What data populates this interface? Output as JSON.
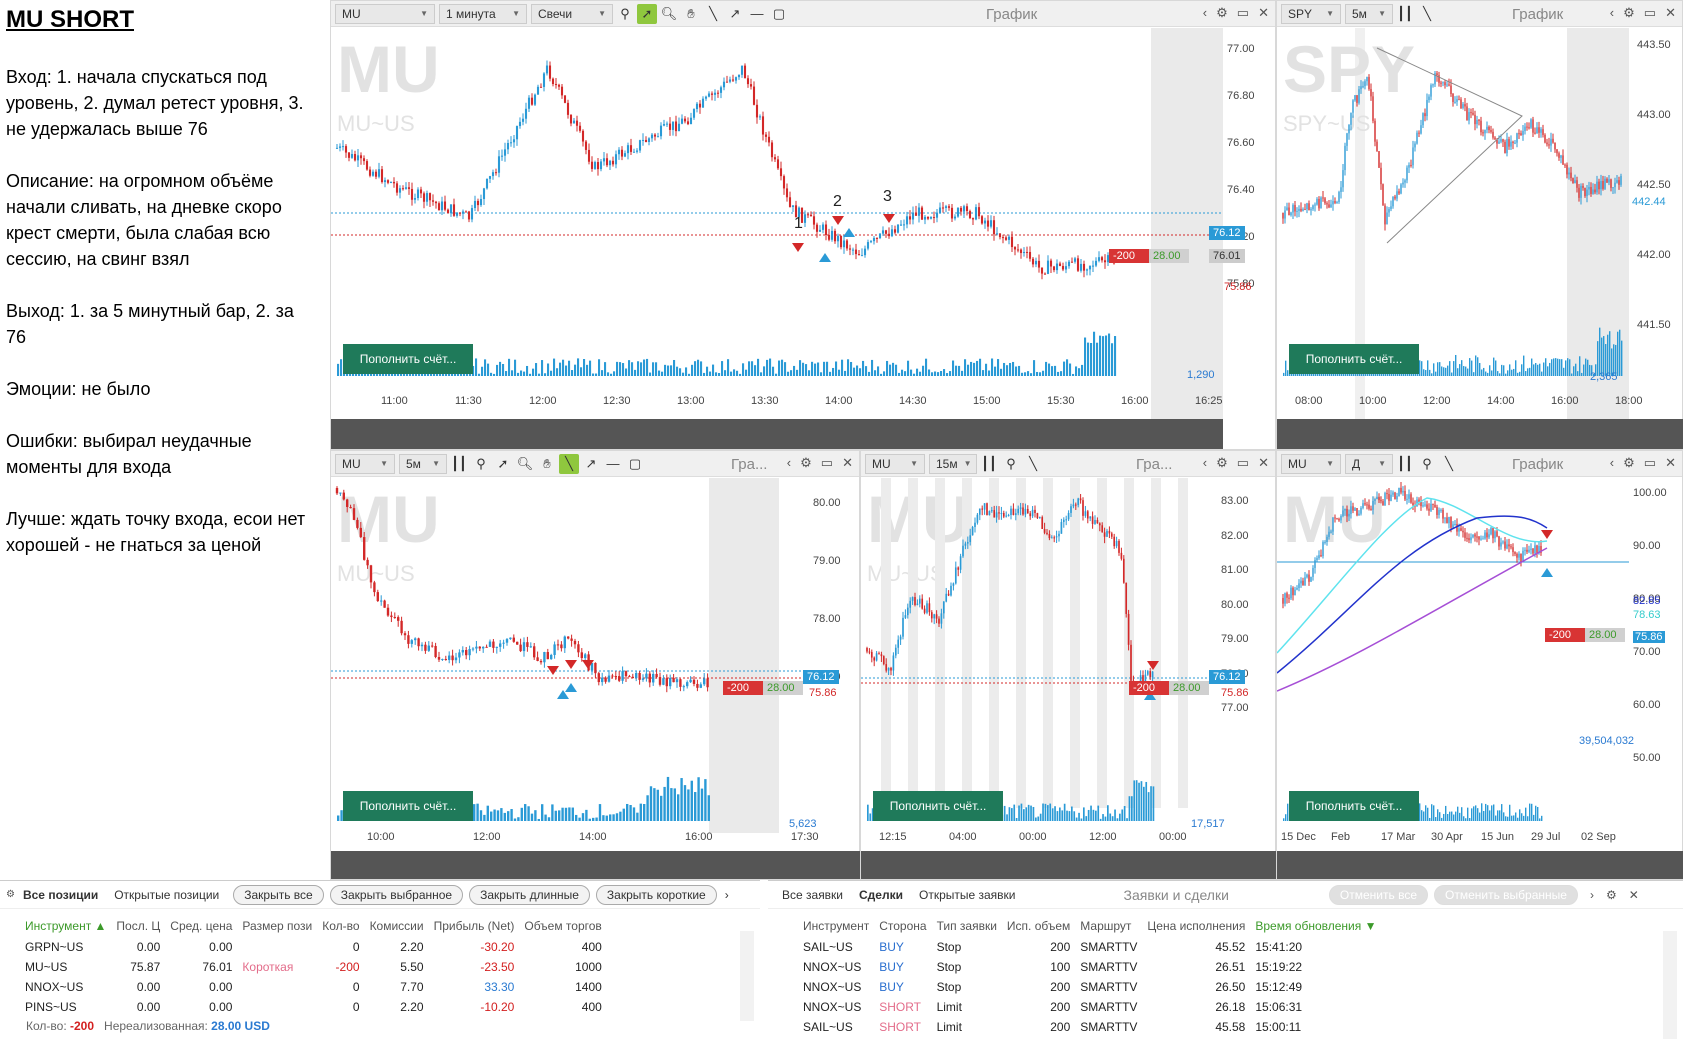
{
  "notes": {
    "title": "MU SHORT",
    "entry": "Вход: 1. начала спускаться под уровень, 2. думал ретест уровня, 3. не удержалась выше 76",
    "description": "Описание: на огромном объёме начали сливать, на дневке скоро крест смерти, была слабая всю сессию, на свинг взял",
    "exit": "Выход: 1. за 5 минутный бар, 2. за 76",
    "emotions": "Эмоции: не было",
    "mistakes": "Ошибки: выбирал неудачные моменты для входа",
    "better": "Лучше: ждать точку входа, есои нет хорошей - не гнаться за ценой"
  },
  "colors": {
    "up": "#2a9ad6",
    "down": "#d32828",
    "accent": "#1f7a5a",
    "green": "#8fc73e"
  },
  "chart1": {
    "symbol": "MU",
    "interval": "1 минута",
    "type": "Свечи",
    "label": "График",
    "wm": "MU",
    "wm_sub": "MU~US",
    "yticks": [
      "77.00",
      "76.80",
      "76.60",
      "76.40",
      "76.20",
      "75.80"
    ],
    "xticks": [
      "11:00",
      "11:30",
      "12:00",
      "12:30",
      "13:00",
      "13:30",
      "14:00",
      "14:30",
      "15:00",
      "15:30",
      "16:00",
      "16:25"
    ],
    "tag_last": "76.12",
    "tag_avg": "76.01",
    "qty": "-200",
    "pnl": "28.00",
    "stop": "75.86",
    "vol": "1,290",
    "fill": "Пополнить счёт...",
    "markers": [
      "1",
      "2",
      "3"
    ]
  },
  "chart2": {
    "symbol": "SPY",
    "interval": "5м",
    "label": "График",
    "wm": "SPY",
    "wm_sub": "SPY~US",
    "yticks": [
      "443.50",
      "443.00",
      "442.50",
      "442.00",
      "441.50"
    ],
    "last": "442.44",
    "xticks": [
      "08:00",
      "10:00",
      "12:00",
      "14:00",
      "16:00",
      "18:00"
    ],
    "vol": "2,365",
    "fill": "Пополнить счёт..."
  },
  "chart3": {
    "symbol": "MU",
    "interval": "5м",
    "label": "Гра...",
    "wm": "MU",
    "wm_sub": "MU~US",
    "yticks": [
      "80.00",
      "79.00",
      "78.00",
      "77.00"
    ],
    "xticks": [
      "10:00",
      "12:00",
      "14:00",
      "16:00",
      "17:30"
    ],
    "tag_last": "76.12",
    "qty": "-200",
    "pnl": "28.00",
    "stop": "75.86",
    "vol": "5,623",
    "fill": "Пополнить счёт..."
  },
  "chart4": {
    "symbol": "MU",
    "interval": "15м",
    "label": "Гра...",
    "wm": "MU",
    "wm_sub": "MU~US",
    "yticks": [
      "83.00",
      "82.00",
      "81.00",
      "80.00",
      "79.00",
      "78.00",
      "77.00"
    ],
    "xticks": [
      "12:15",
      "04:00",
      "00:00",
      "12:00",
      "00:00"
    ],
    "tag_last": "76.12",
    "qty": "-200",
    "pnl": "28.00",
    "stop": "75.86",
    "vol": "17,517",
    "fill": "Пополнить счёт..."
  },
  "chart5": {
    "symbol": "MU",
    "interval": "Д",
    "label": "График",
    "wm": "MU",
    "yticks": [
      "100.00",
      "90.00",
      "80.00",
      "70.00",
      "60.00",
      "50.00"
    ],
    "ma1": "82.85",
    "ma2": "78.63",
    "ma3": "77.86",
    "last": "75.86",
    "qty": "-200",
    "pnl": "28.00",
    "xticks": [
      "15 Dec",
      "Feb",
      "17 Mar",
      "30 Apr",
      "15 Jun",
      "29 Jul",
      "02 Sep"
    ],
    "vol": "39,504,032",
    "fill": "Пополнить счёт..."
  },
  "positions": {
    "tabs": [
      "Все позиции",
      "Открытые позиции"
    ],
    "buttons": [
      "Закрыть все",
      "Закрыть выбранное",
      "Закрыть длинные",
      "Закрыть короткие"
    ],
    "headers": [
      "Инструмент ▲",
      "Посл. Ц",
      "Сред. цена",
      "Размер пози",
      "Кол-во",
      "Комиссии",
      "Прибыль (Net)",
      "Объем торгов"
    ],
    "rows": [
      {
        "sym": "GRPN~US",
        "last": "0.00",
        "avg": "0.00",
        "side": "",
        "qty": "0",
        "fee": "2.20",
        "pnl": "-30.20",
        "vol": "400"
      },
      {
        "sym": "MU~US",
        "last": "75.87",
        "avg": "76.01",
        "side": "Короткая",
        "qty": "-200",
        "fee": "5.50",
        "pnl": "-23.50",
        "vol": "1000"
      },
      {
        "sym": "NNOX~US",
        "last": "0.00",
        "avg": "0.00",
        "side": "",
        "qty": "0",
        "fee": "7.70",
        "pnl": "33.30",
        "vol": "1400"
      },
      {
        "sym": "PINS~US",
        "last": "0.00",
        "avg": "0.00",
        "side": "",
        "qty": "0",
        "fee": "2.20",
        "pnl": "-10.20",
        "vol": "400"
      }
    ],
    "footer_qty_label": "Кол-во:",
    "footer_qty": "-200",
    "footer_unreal_label": "Нереализованная:",
    "footer_unreal": "28.00 USD"
  },
  "orders": {
    "tabs": [
      "Все заявки",
      "Сделки",
      "Открытые заявки"
    ],
    "title": "Заявки и сделки",
    "buttons": [
      "Отменить все",
      "Отменить выбранные"
    ],
    "headers": [
      "Инструмент",
      "Сторона",
      "Тип заявки",
      "Исп. объем",
      "Маршрут",
      "Цена исполнения",
      "Время обновления ▼"
    ],
    "rows": [
      {
        "sym": "SAIL~US",
        "side": "BUY",
        "type": "Stop",
        "qty": "200",
        "route": "SMARTTV",
        "price": "45.52",
        "time": "15:41:20"
      },
      {
        "sym": "NNOX~US",
        "side": "BUY",
        "type": "Stop",
        "qty": "100",
        "route": "SMARTTV",
        "price": "26.51",
        "time": "15:19:22"
      },
      {
        "sym": "NNOX~US",
        "side": "BUY",
        "type": "Stop",
        "qty": "200",
        "route": "SMARTTV",
        "price": "26.50",
        "time": "15:12:49"
      },
      {
        "sym": "NNOX~US",
        "side": "SHORT",
        "type": "Limit",
        "qty": "200",
        "route": "SMARTTV",
        "price": "26.18",
        "time": "15:06:31"
      },
      {
        "sym": "SAIL~US",
        "side": "SHORT",
        "type": "Limit",
        "qty": "200",
        "route": "SMARTTV",
        "price": "45.58",
        "time": "15:00:11"
      }
    ]
  }
}
